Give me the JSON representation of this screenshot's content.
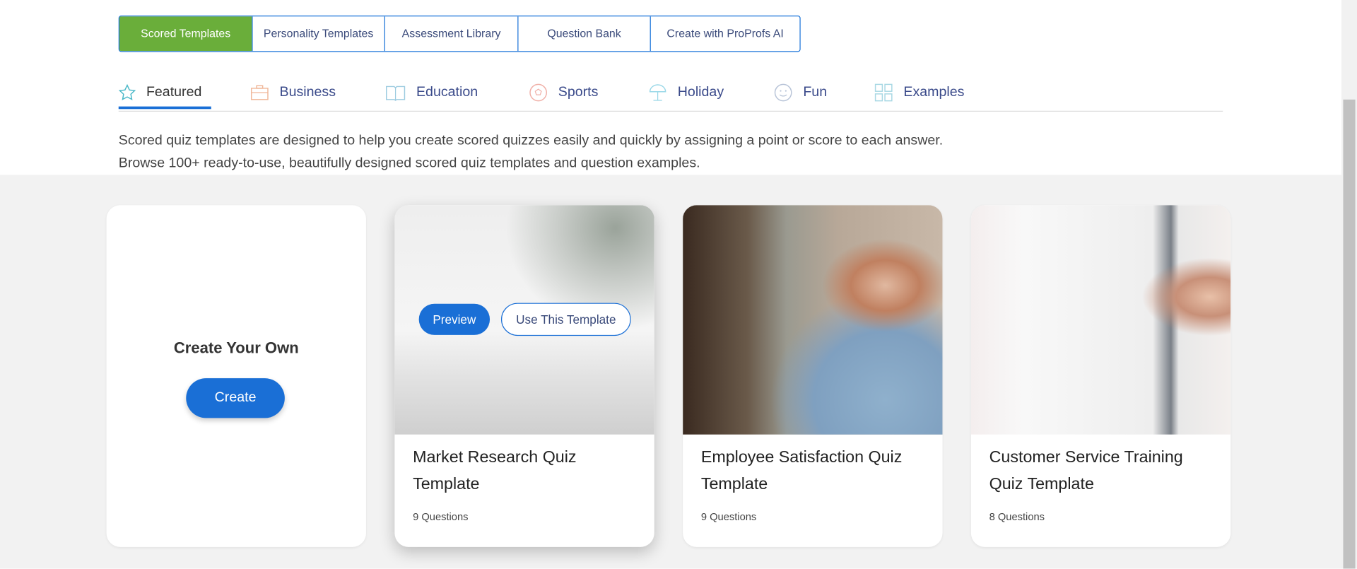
{
  "top_tabs": [
    "Scored Templates",
    "Personality Templates",
    "Assessment Library",
    "Question Bank",
    "Create with ProProfs AI"
  ],
  "active_top_tab": "Scored Templates",
  "categories": [
    {
      "label": "Featured",
      "icon": "star-icon",
      "color": "#4ab8c8"
    },
    {
      "label": "Business",
      "icon": "briefcase-icon",
      "color": "#f0b89a"
    },
    {
      "label": "Education",
      "icon": "book-icon",
      "color": "#9ccbe0"
    },
    {
      "label": "Sports",
      "icon": "soccer-ball-icon",
      "color": "#f0b0a8"
    },
    {
      "label": "Holiday",
      "icon": "beach-umbrella-icon",
      "color": "#9ad8e8"
    },
    {
      "label": "Fun",
      "icon": "smiley-icon",
      "color": "#b8c4d8"
    },
    {
      "label": "Examples",
      "icon": "grid-icon",
      "color": "#a8d8e4"
    }
  ],
  "active_category": "Featured",
  "description": {
    "line1": "Scored quiz templates are designed to help you create scored quizzes easily and quickly by assigning a point or score to each answer.",
    "line2": "Browse 100+ ready-to-use, beautifully designed scored quiz templates and question examples."
  },
  "create_card": {
    "title": "Create Your Own",
    "button": "Create"
  },
  "cards": [
    {
      "title": "Market Research Quiz Template",
      "questions": "9 Questions",
      "preview": "Preview",
      "use": "Use This Template"
    },
    {
      "title": "Employee Satisfaction Quiz Template",
      "questions": "9 Questions"
    },
    {
      "title": "Customer Service Training Quiz Template",
      "questions": "8 Questions"
    }
  ],
  "colors": {
    "primary": "#1a6fd6",
    "green": "#6aae3a"
  }
}
